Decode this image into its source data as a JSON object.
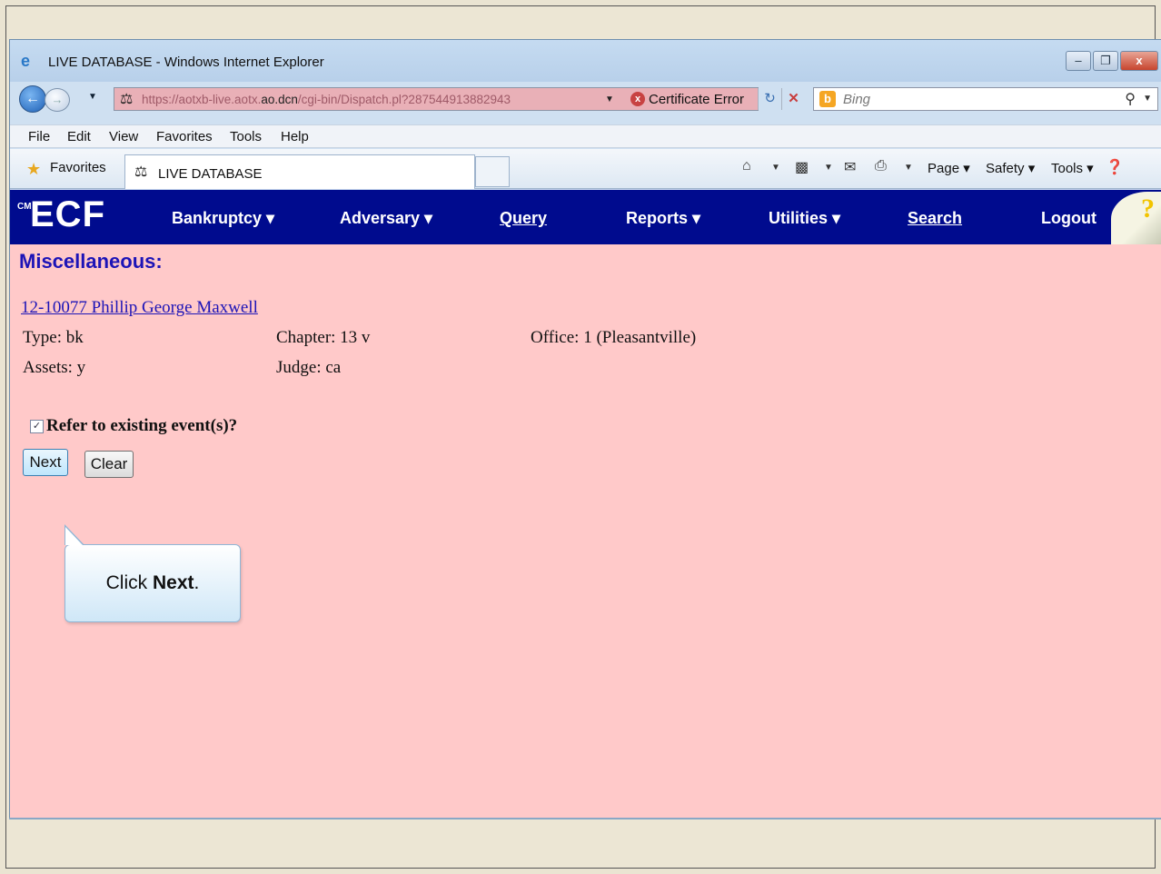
{
  "window": {
    "title": "LIVE DATABASE - Windows Internet Explorer",
    "controls": {
      "minimize": "–",
      "restore": "❐",
      "close": "x"
    }
  },
  "address": {
    "url_prefix": "https://aotxb-live.aotx.",
    "url_host": "ao.dcn",
    "url_suffix": "/cgi-bin/Dispatch.pl?287544913882943",
    "certificate_text": "Certificate Error",
    "search_placeholder": "Bing"
  },
  "menubar": {
    "items": [
      "File",
      "Edit",
      "View",
      "Favorites",
      "Tools",
      "Help"
    ]
  },
  "favbar": {
    "favorites_label": "Favorites",
    "tab_label": "LIVE DATABASE",
    "commands": {
      "page": "Page ▾",
      "safety": "Safety ▾",
      "tools": "Tools ▾"
    }
  },
  "ecf": {
    "logo_cm": "CM",
    "logo_text": "ECF",
    "nav": {
      "bankruptcy": "Bankruptcy ▾",
      "adversary": "Adversary ▾",
      "query": "Query",
      "reports": "Reports ▾",
      "utilities": "Utilities ▾",
      "search": "Search",
      "logout": "Logout"
    },
    "help": "?"
  },
  "page": {
    "heading": "Miscellaneous:",
    "case_link": "12-10077 Phillip George Maxwell",
    "type": "Type: bk",
    "chapter": "Chapter: 13 v",
    "office": "Office: 1 (Pleasantville)",
    "assets": "Assets: y",
    "judge": "Judge: ca",
    "refer_label": "Refer to existing event(s)?",
    "next_label": "Next",
    "clear_label": "Clear"
  },
  "callout": {
    "prefix": "Click ",
    "emphasis": "Next",
    "suffix": "."
  },
  "colors": {
    "ecf_bar": "#000b8e",
    "content_bg": "#ffc9c9",
    "link": "#1d14b7"
  }
}
